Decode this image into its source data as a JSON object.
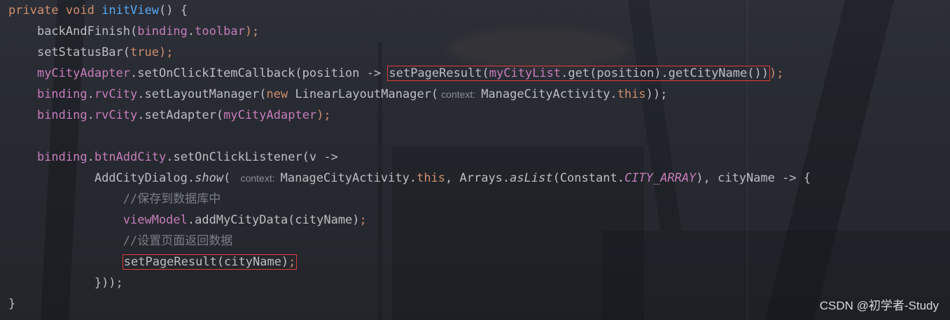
{
  "code": {
    "l1": {
      "kw1": "private",
      "kw2": "void",
      "method": "initView",
      "rest": "() {"
    },
    "l2": {
      "call": "backAndFinish(",
      "obj": "binding",
      "dot": ".",
      "field": "toolbar",
      "end": ");"
    },
    "l3": {
      "call": "setStatusBar(",
      "lit": "true",
      "end": ");"
    },
    "l4": {
      "field": "myCityAdapter",
      "call": ".setOnClickItemCallback(position -> ",
      "boxed": {
        "pre": "setPageResult(",
        "field": "myCityList",
        "post": ".get(position).getCityName()"
      },
      "tail_in": ")",
      "end": ");"
    },
    "l5": {
      "field1": "binding",
      "dot": ".",
      "field2": "rvCity",
      "call": ".setLayoutManager(",
      "kw": "new",
      "cls": " LinearLayoutManager(",
      "hint": "context:",
      "arg": "ManageCityActivity.",
      "this": "this",
      "end": "));"
    },
    "l6": {
      "field1": "binding",
      "dot": ".",
      "field2": "rvCity",
      "call": ".setAdapter(",
      "field3": "myCityAdapter",
      "end": ");"
    },
    "l8": {
      "field1": "binding",
      "dot": ".",
      "field2": "btnAddCity",
      "call": ".setOnClickListener(v ->"
    },
    "l9": {
      "cls": "AddCityDialog.",
      "method": "show",
      "paren": "(",
      "hint": "context:",
      "arg": "ManageCityActivity.",
      "this": "this",
      "comma": ", Arrays.",
      "aslist": "asList",
      "arg2": "(Constant.",
      "const": "CITY_ARRAY",
      "end": "), cityName -> {"
    },
    "l10": {
      "comment": "//保存到数据库中"
    },
    "l11": {
      "field": "viewModel",
      "call": ".addMyCityData(cityName)",
      "end": ";"
    },
    "l12": {
      "comment": "//设置页面返回数据"
    },
    "l13": {
      "call": "setPageResult(cityName)",
      "end": ";"
    },
    "l14": {
      "text": "}));"
    },
    "l15": {
      "text": "}"
    }
  },
  "watermark": "CSDN @初学者-Study",
  "colors": {
    "keyword": "#cf8e6d",
    "method": "#56a8f5",
    "field": "#c77dbb",
    "comment": "#7a7e85",
    "text": "#bcbec4",
    "highlight_box": "#e03c3c"
  }
}
